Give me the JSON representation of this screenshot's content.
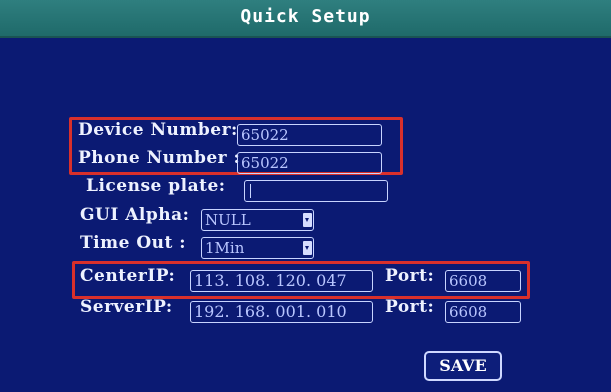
{
  "title": "Quick Setup",
  "form": {
    "device_number": {
      "label": "Device Number:",
      "value": "65022"
    },
    "phone_number": {
      "label": "Phone Number :",
      "value": "65022"
    },
    "license_plate": {
      "label": "License plate:",
      "value": ""
    },
    "gui_alpha": {
      "label": "GUI Alpha:",
      "value": "NULL"
    },
    "time_out": {
      "label": "Time Out :",
      "value": "1Min"
    },
    "center_ip": {
      "label": "CenterIP:",
      "value": "113. 108. 120. 047",
      "port_label": "Port:",
      "port_value": "6608"
    },
    "server_ip": {
      "label": "ServerIP:",
      "value": "192. 168. 001. 010",
      "port_label": "Port:",
      "port_value": "6608"
    }
  },
  "save_label": "SAVE",
  "colors": {
    "background": "#0b1a73",
    "title_bar": "#2f7f7f",
    "highlight": "#d9302b",
    "text": "#eef2ff"
  }
}
